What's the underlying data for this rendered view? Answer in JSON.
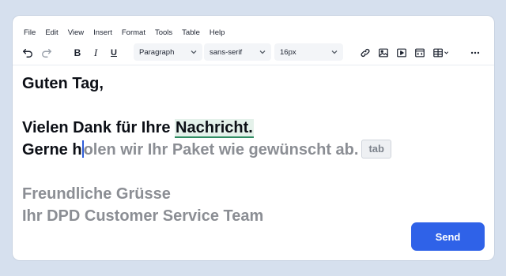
{
  "menubar": {
    "items": [
      "File",
      "Edit",
      "View",
      "Insert",
      "Format",
      "Tools",
      "Table",
      "Help"
    ]
  },
  "toolbar": {
    "bold_label": "B",
    "italic_label": "I",
    "underline_label": "U",
    "block_format": "Paragraph",
    "font_family": "sans-serif",
    "font_size": "16px",
    "icons": [
      "undo-icon",
      "redo-icon",
      "link-icon",
      "image-icon",
      "media-icon",
      "code-sample-icon",
      "table-icon",
      "more-icon"
    ]
  },
  "document": {
    "greeting": "Guten Tag,",
    "thanks_prefix": "Vielen Dank für Ihre ",
    "thanks_highlight": "Nachricht.",
    "typed_text": "Gerne h",
    "suggestion_text": "olen wir Ihr Paket wie gewünscht ab.",
    "accept_hint": "tab",
    "closing": "Freundliche Grüsse",
    "signature": "Ihr DPD Customer Service Team"
  },
  "actions": {
    "send_label": "Send"
  },
  "colors": {
    "accent": "#2f62e8",
    "highlight_bg": "#e4f1ea",
    "highlight_underline": "#2f8c63",
    "suggestion_text": "#8b8e94",
    "background": "#d6e0ee"
  }
}
